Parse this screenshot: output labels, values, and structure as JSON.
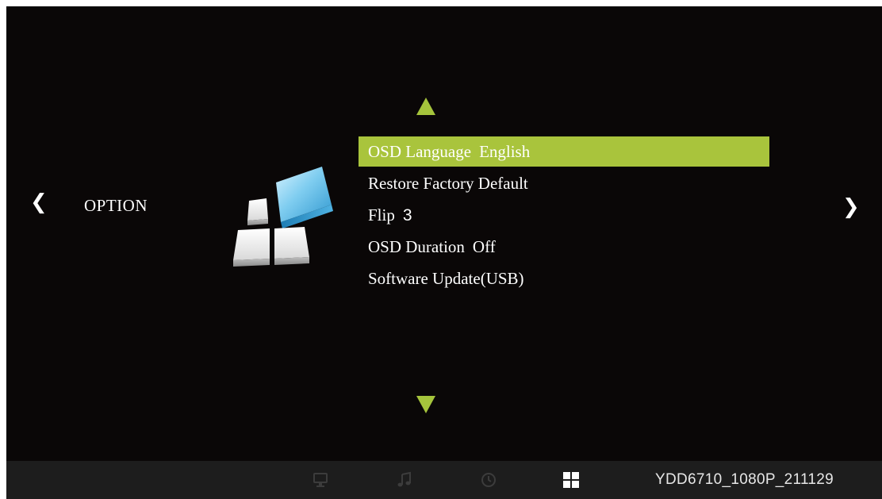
{
  "osd": {
    "category": "OPTION",
    "nav_left_glyph": "❮",
    "nav_right_glyph": "❯",
    "accent_color": "#a9c43c",
    "menu_items": [
      {
        "label": "OSD Language",
        "value": "English",
        "selected": true
      },
      {
        "label": "Restore Factory Default",
        "value": "",
        "selected": false
      },
      {
        "label": "Flip",
        "value": "3",
        "selected": false
      },
      {
        "label": "OSD Duration",
        "value": "Off",
        "selected": false
      },
      {
        "label": "Software Update(USB)",
        "value": "",
        "selected": false
      }
    ]
  },
  "bottom_bar": {
    "icons": [
      "picture-icon",
      "music-icon",
      "time-icon",
      "option-icon"
    ],
    "active_icon": "option-icon",
    "version": "YDD6710_1080P_211129"
  }
}
